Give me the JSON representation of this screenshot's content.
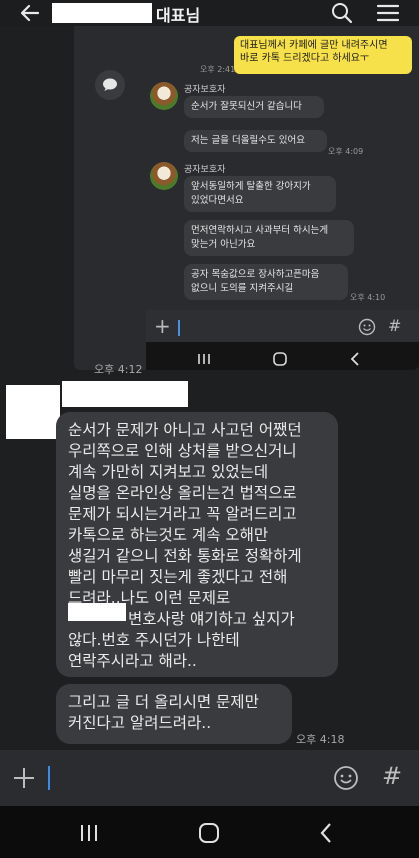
{
  "header": {
    "title": "대표님",
    "back_icon": "arrow-left-icon",
    "search_icon": "search-icon",
    "menu_icon": "hamburger-menu-icon"
  },
  "screenshot": {
    "yellow_message": [
      "대표님께서 카페에 글만 내려주시면",
      "바로 카톡 드리겠다고 하세요ㅜ"
    ],
    "yellow_time": "오후 2:41",
    "sender_name": "공자보호자",
    "group1": [
      "순서가 잘못되신거 같습니다",
      "저는 글을 더올릴수도 있어요"
    ],
    "group1_time": "오후 4:09",
    "group2_line1": [
      "앞서동일하게 탈출한 강아지가",
      "있었다면서요"
    ],
    "group2_line2": [
      "먼저연락하시고 사과부터 하시는게",
      "맞는거 아닌가요"
    ],
    "group2_line3": [
      "공자 목숨값으로 장사하고픈마음",
      "없으니 도의를 지켜주시길"
    ],
    "group2_time": "오후 4:10",
    "input_plus": "+",
    "emoji_icon": "emoji-icon",
    "hash": "#"
  },
  "screenshot_time": "오후 4:12",
  "messages": {
    "main_lines": [
      "순서가 문제가 아니고 사고던 어쨌던",
      "우리쪽으로 인해 상처를 받으신거니",
      "계속 가만히 지켜보고 있었는데",
      "실명을 온라인상 올리는건 법적으로",
      "문제가 되시는거라고 꼭 알려드리고",
      "카톡으로 하는것도 계속 오해만",
      "생길거 같으니 전화 통화로 정확하게",
      "빨리 마무리 짓는게 좋겠다고 전해",
      "드려라..나도 이런 문제로",
      "변호사랑 얘기하고 싶지가",
      "않다.번호 주시던가 나한테",
      "연락주시라고 해라.."
    ],
    "second_lines": [
      "그리고 글 더 올리시면 문제만",
      "커진다고 알려드려라.."
    ],
    "second_time": "오후 4:18"
  },
  "input": {
    "plus": "+",
    "emoji_icon": "emoji-icon",
    "hash": "#"
  },
  "nav": {
    "recent_icon": "recent-apps-icon",
    "home_icon": "home-icon",
    "back_icon": "back-icon"
  }
}
